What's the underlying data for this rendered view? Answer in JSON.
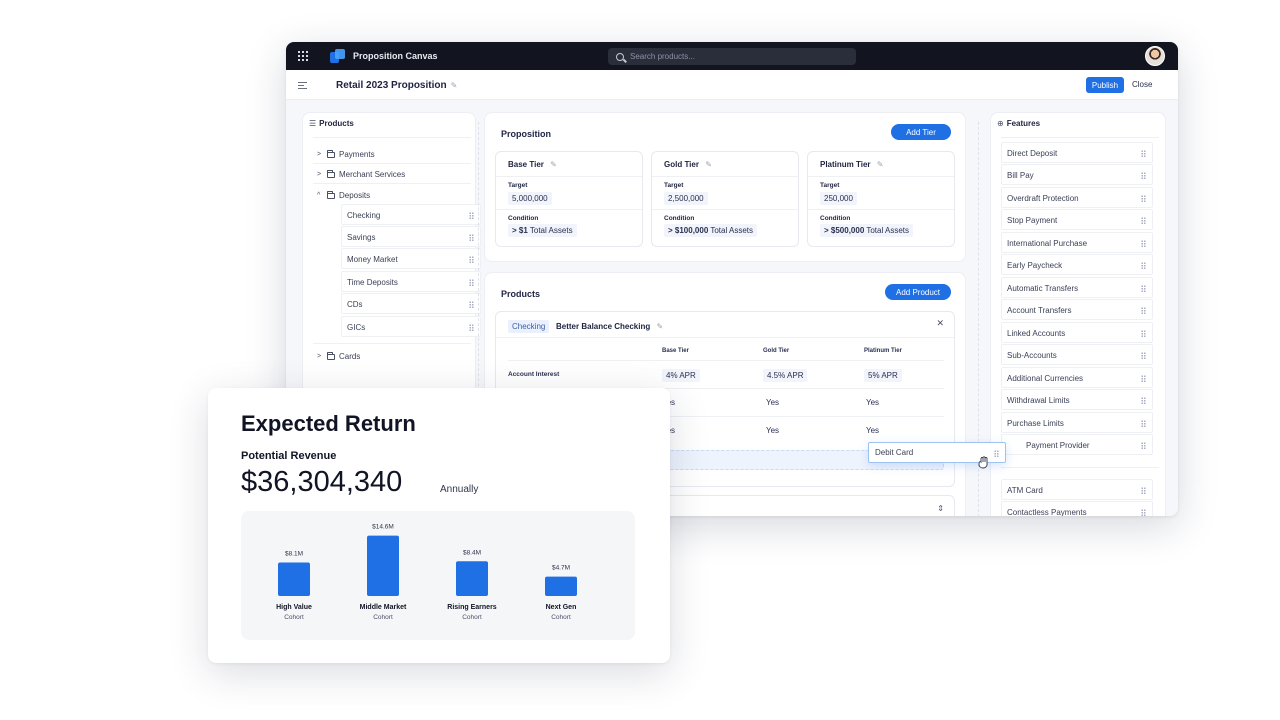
{
  "app": {
    "title": "Proposition Canvas",
    "search_placeholder": "Search products...",
    "page_title": "Retail 2023 Proposition",
    "publish_label": "Publish",
    "close_label": "Close",
    "accent": "#1f6fe5"
  },
  "products_panel": {
    "title": "Products",
    "groups": [
      {
        "label": "Payments",
        "expanded": false
      },
      {
        "label": "Merchant Services",
        "expanded": false
      },
      {
        "label": "Deposits",
        "expanded": true,
        "children": [
          "Checking",
          "Savings",
          "Money Market",
          "Time Deposits",
          "CDs",
          "GICs"
        ]
      },
      {
        "label": "Cards",
        "expanded": false
      }
    ]
  },
  "proposition": {
    "title": "Proposition",
    "add_tier_label": "Add Tier",
    "target_label": "Target",
    "condition_label": "Condition",
    "tiers": [
      {
        "name": "Base Tier",
        "target": "5,000,000",
        "condition_bold": "> $1",
        "condition_rest": "Total Assets"
      },
      {
        "name": "Gold Tier",
        "target": "2,500,000",
        "condition_bold": "> $100,000",
        "condition_rest": "Total Assets"
      },
      {
        "name": "Platinum Tier",
        "target": "250,000",
        "condition_bold": "> $500,000",
        "condition_rest": "Total Assets"
      }
    ]
  },
  "products_section": {
    "title": "Products",
    "add_product_label": "Add Product",
    "product_tag": "Checking",
    "product_name": "Better Balance Checking",
    "columns": [
      "Base Tier",
      "Gold Tier",
      "Platinum Tier"
    ],
    "rows": [
      {
        "label": "Account Interest",
        "values": [
          "4% APR",
          "4.5% APR",
          "5% APR"
        ]
      },
      {
        "label": "",
        "values": [
          "Yes",
          "Yes",
          "Yes"
        ]
      },
      {
        "label": "",
        "values": [
          "Yes",
          "Yes",
          "Yes"
        ]
      }
    ],
    "drag_chip": "Debit Card"
  },
  "features_panel": {
    "title": "Features",
    "items": [
      "Direct Deposit",
      "Bill Pay",
      "Overdraft Protection",
      "Stop Payment",
      "International Purchase",
      "Early Paycheck",
      "Automatic Transfers",
      "Account Transfers",
      "Linked Accounts",
      "Sub-Accounts",
      "Additional Currencies",
      "Withdrawal Limits",
      "Purchase Limits",
      "Payment Provider"
    ],
    "items_lower": [
      "ATM Card",
      "Contactless Payments"
    ]
  },
  "expected_return": {
    "title": "Expected Return",
    "revenue_label": "Potential Revenue",
    "revenue_value": "$36,304,340",
    "revenue_unit": "Annually"
  },
  "chart_data": {
    "type": "bar",
    "categories": [
      "High Value",
      "Middle Market",
      "Rising Earners",
      "Next Gen"
    ],
    "sublabels": [
      "Cohort",
      "Cohort",
      "Cohort",
      "Cohort"
    ],
    "values": [
      8.1,
      14.6,
      8.4,
      4.7
    ],
    "value_labels": [
      "$8.1M",
      "$14.6M",
      "$8.4M",
      "$4.7M"
    ],
    "color": "#1f6fe5",
    "ylim": [
      0,
      15
    ]
  }
}
